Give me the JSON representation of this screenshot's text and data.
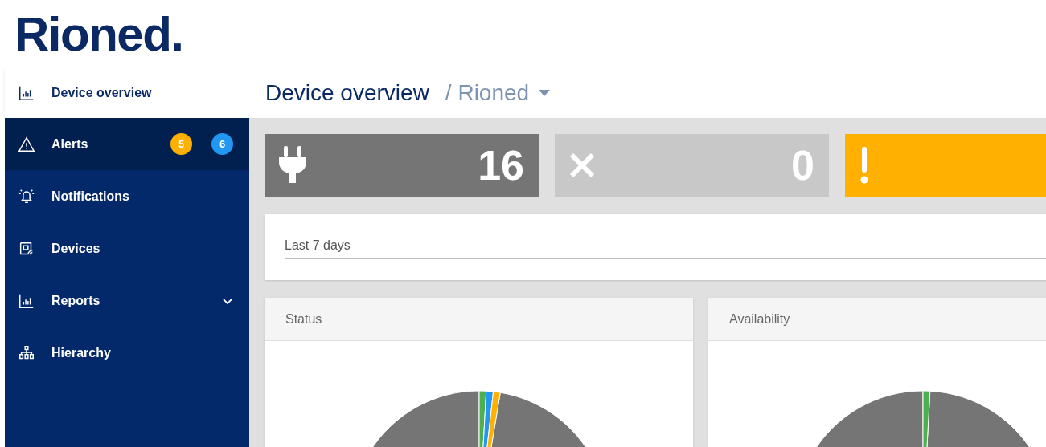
{
  "logo": {
    "text": "Rioned."
  },
  "sidebar": {
    "header": {
      "label": "Device overview",
      "kind": "chart"
    },
    "items": [
      {
        "label": "Alerts",
        "kind": "warning",
        "selected": true,
        "badges": [
          {
            "text": "5",
            "color": "#ffb000"
          },
          {
            "text": "6",
            "color": "#2196f3"
          }
        ]
      },
      {
        "label": "Notifications",
        "kind": "bell",
        "selected": false
      },
      {
        "label": "Devices",
        "kind": "device",
        "selected": false
      },
      {
        "label": "Reports",
        "kind": "chart",
        "expanded": false,
        "selected": false
      },
      {
        "label": "Hierarchy",
        "kind": "tree",
        "selected": false
      }
    ]
  },
  "page_header": {
    "title": "Device overview",
    "breadcrumb": "/ Rioned"
  },
  "stat_cards": [
    {
      "kind": "plug",
      "value": "16",
      "color": "#757575"
    },
    {
      "kind": "cross",
      "value": "0",
      "color": "#c8c8c8"
    },
    {
      "kind": "alert",
      "color": "#ffb000"
    }
  ],
  "filter": {
    "value": "Last 7 days"
  },
  "chart_panels": [
    {
      "title": "Status"
    },
    {
      "title": "Availability"
    }
  ]
}
